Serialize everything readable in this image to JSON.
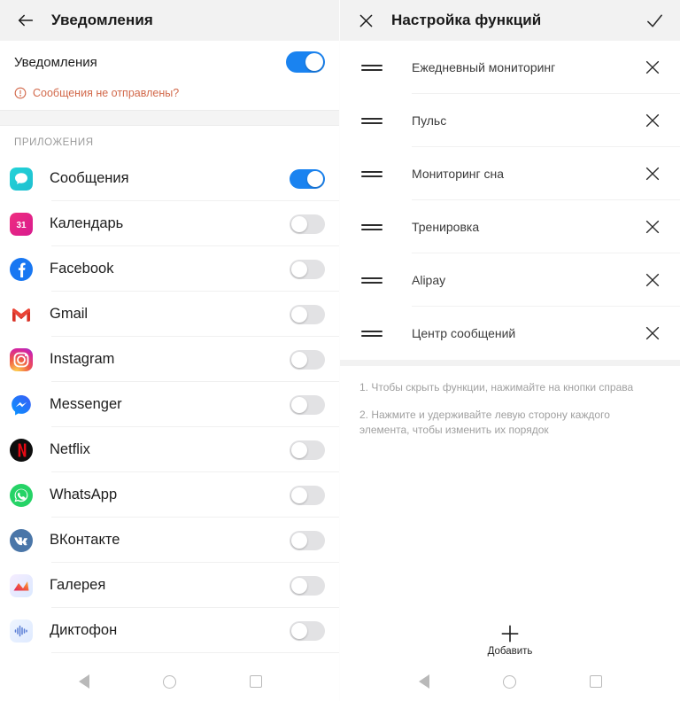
{
  "left_screen": {
    "header": {
      "back_icon": "arrow-left-icon",
      "title": "Уведомления"
    },
    "master": {
      "label": "Уведомления",
      "toggle_state": "on"
    },
    "warning": {
      "icon": "exclamation-circle-icon",
      "text": "Сообщения не отправлены?"
    },
    "section_label": "ПРИЛОЖЕНИЯ",
    "apps": [
      {
        "name": "Сообщения",
        "icon": "messages-icon",
        "toggle_state": "on"
      },
      {
        "name": "Календарь",
        "icon": "calendar-icon",
        "toggle_state": "off"
      },
      {
        "name": "Facebook",
        "icon": "facebook-icon",
        "toggle_state": "off"
      },
      {
        "name": "Gmail",
        "icon": "gmail-icon",
        "toggle_state": "off"
      },
      {
        "name": "Instagram",
        "icon": "instagram-icon",
        "toggle_state": "off"
      },
      {
        "name": "Messenger",
        "icon": "messenger-icon",
        "toggle_state": "off"
      },
      {
        "name": "Netflix",
        "icon": "netflix-icon",
        "toggle_state": "off"
      },
      {
        "name": "WhatsApp",
        "icon": "whatsapp-icon",
        "toggle_state": "off"
      },
      {
        "name": "ВКонтакте",
        "icon": "vk-icon",
        "toggle_state": "off"
      },
      {
        "name": "Галерея",
        "icon": "gallery-icon",
        "toggle_state": "off"
      },
      {
        "name": "Диктофон",
        "icon": "recorder-icon",
        "toggle_state": "off"
      }
    ],
    "navbar": {
      "back": "back-triangle-icon",
      "home": "home-circle-icon",
      "recents": "recents-square-icon"
    }
  },
  "right_screen": {
    "header": {
      "close_icon": "close-x-icon",
      "title": "Настройка функций",
      "confirm_icon": "check-icon"
    },
    "features": [
      {
        "name": "Ежедневный мониторинг",
        "drag": "drag-handle-icon",
        "remove": "remove-x-icon"
      },
      {
        "name": "Пульс",
        "drag": "drag-handle-icon",
        "remove": "remove-x-icon"
      },
      {
        "name": "Мониторинг сна",
        "drag": "drag-handle-icon",
        "remove": "remove-x-icon"
      },
      {
        "name": "Тренировка",
        "drag": "drag-handle-icon",
        "remove": "remove-x-icon"
      },
      {
        "name": "Alipay",
        "drag": "drag-handle-icon",
        "remove": "remove-x-icon"
      },
      {
        "name": "Центр сообщений",
        "drag": "drag-handle-icon",
        "remove": "remove-x-icon"
      }
    ],
    "hints": [
      "1. Чтобы скрыть функции, нажимайте на кнопки справа",
      "2. Нажмите и удерживайте левую сторону каждого элемента, чтобы изменить их порядок"
    ],
    "add_button": {
      "icon": "plus-icon",
      "label": "Добавить"
    },
    "navbar": {
      "back": "back-triangle-icon",
      "home": "home-circle-icon",
      "recents": "recents-square-icon"
    }
  },
  "colors": {
    "toggle_on": "#1a83f0",
    "toggle_off": "#e2e2e4",
    "warning_text": "#d2694b",
    "header_bg": "#f2f2f2",
    "hint_text": "#a0a0a0"
  }
}
